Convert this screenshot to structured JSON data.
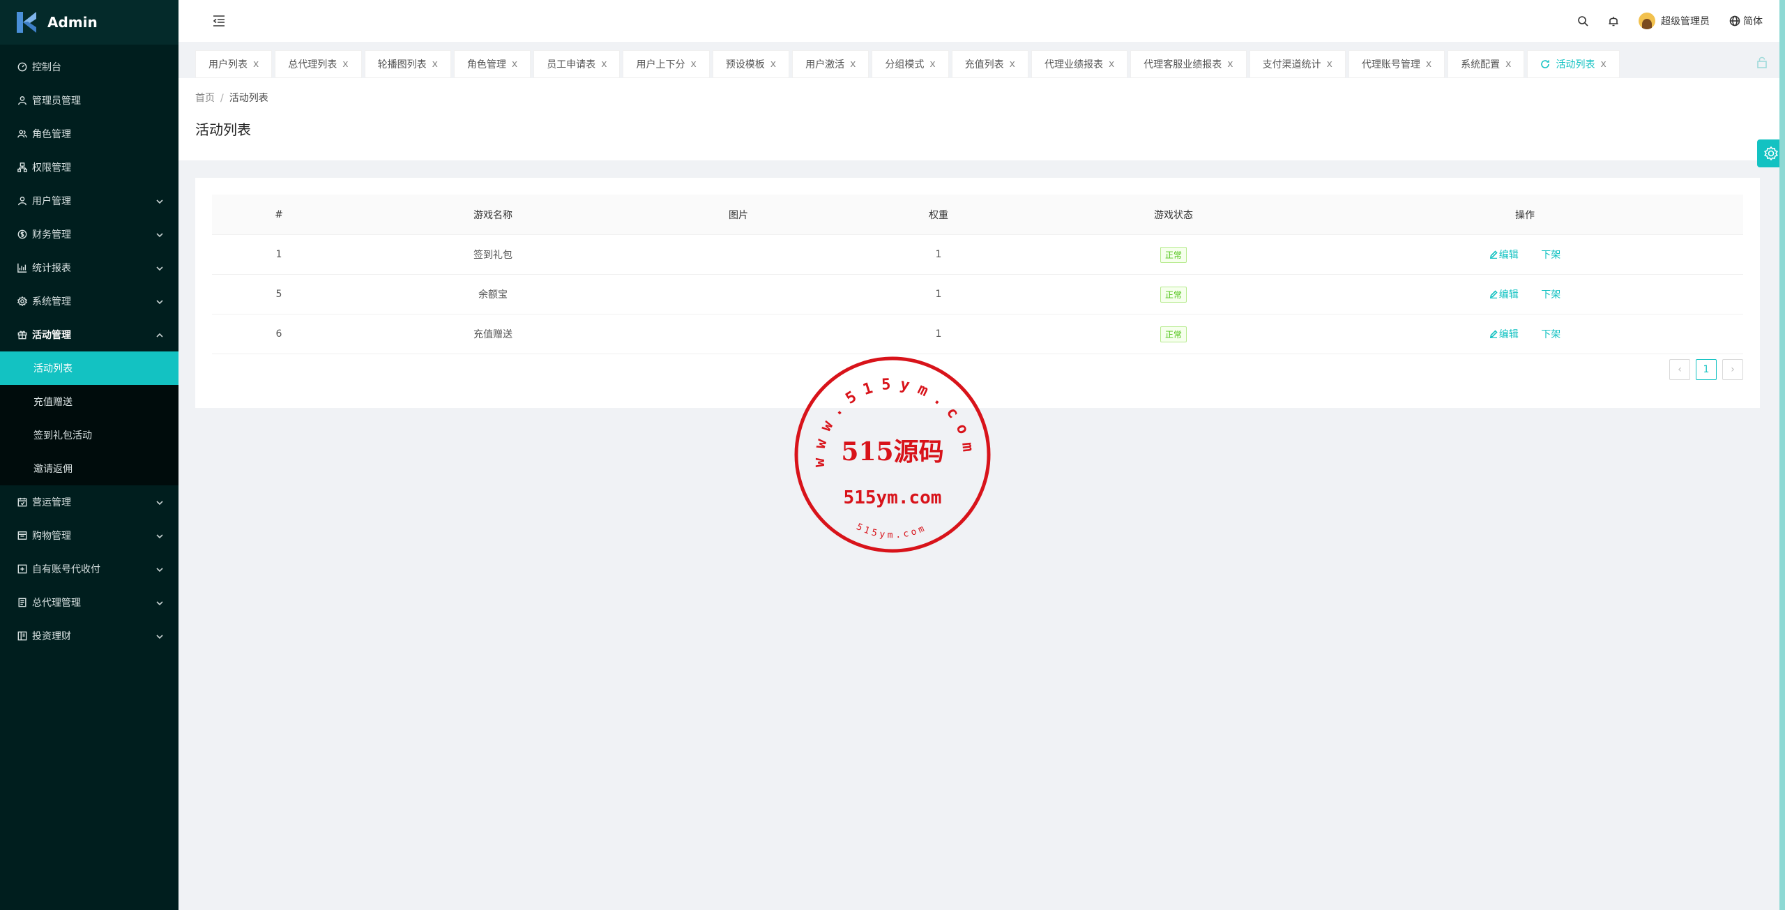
{
  "app": {
    "title": "Admin"
  },
  "sidebar": {
    "items": [
      {
        "label": "控制台",
        "icon": "dashboard-icon"
      },
      {
        "label": "管理员管理",
        "icon": "user-icon"
      },
      {
        "label": "角色管理",
        "icon": "users-icon"
      },
      {
        "label": "权限管理",
        "icon": "permission-icon"
      },
      {
        "label": "用户管理",
        "icon": "user-icon",
        "expandable": true
      },
      {
        "label": "财务管理",
        "icon": "money-icon",
        "expandable": true
      },
      {
        "label": "统计报表",
        "icon": "chart-icon",
        "expandable": true
      },
      {
        "label": "系统管理",
        "icon": "gear-icon",
        "expandable": true
      },
      {
        "label": "活动管理",
        "icon": "gift-icon",
        "expandable": true,
        "open": true
      }
    ],
    "activity_sub": [
      "活动列表",
      "充值赠送",
      "签到礼包活动",
      "邀请返佣"
    ],
    "items_after": [
      {
        "label": "营运管理",
        "icon": "calendar-icon"
      },
      {
        "label": "购物管理",
        "icon": "shop-icon"
      },
      {
        "label": "自有账号代收付",
        "icon": "account-icon"
      },
      {
        "label": "总代理管理",
        "icon": "doc-icon"
      },
      {
        "label": "投资理财",
        "icon": "invest-icon"
      }
    ]
  },
  "header": {
    "user": "超级管理员",
    "lang": "简体"
  },
  "tabs": [
    "用户列表",
    "总代理列表",
    "轮播图列表",
    "角色管理",
    "员工申请表",
    "用户上下分",
    "预设模板",
    "用户激活",
    "分组模式",
    "充值列表",
    "代理业绩报表",
    "代理客服业绩报表",
    "支付渠道统计",
    "代理账号管理",
    "系统配置",
    "活动列表"
  ],
  "tab_close": "x",
  "breadcrumb": {
    "home": "首页",
    "sep": "/",
    "current": "活动列表"
  },
  "page_title": "活动列表",
  "table": {
    "headers": [
      "#",
      "游戏名称",
      "图片",
      "权重",
      "游戏状态",
      "操作"
    ],
    "rows": [
      {
        "id": "1",
        "name": "签到礼包",
        "weight": "1",
        "status": "正常"
      },
      {
        "id": "5",
        "name": "余额宝",
        "weight": "1",
        "status": "正常"
      },
      {
        "id": "6",
        "name": "充值赠送",
        "weight": "1",
        "status": "正常"
      }
    ],
    "edit_label": "编辑",
    "offline_label": "下架"
  },
  "pagination": {
    "current": "1",
    "prev": "‹",
    "next": "›"
  },
  "watermark": {
    "center": "515源码",
    "domain": "515ym.com",
    "ring": "www.515ym.com",
    "small": "515ym.com"
  }
}
